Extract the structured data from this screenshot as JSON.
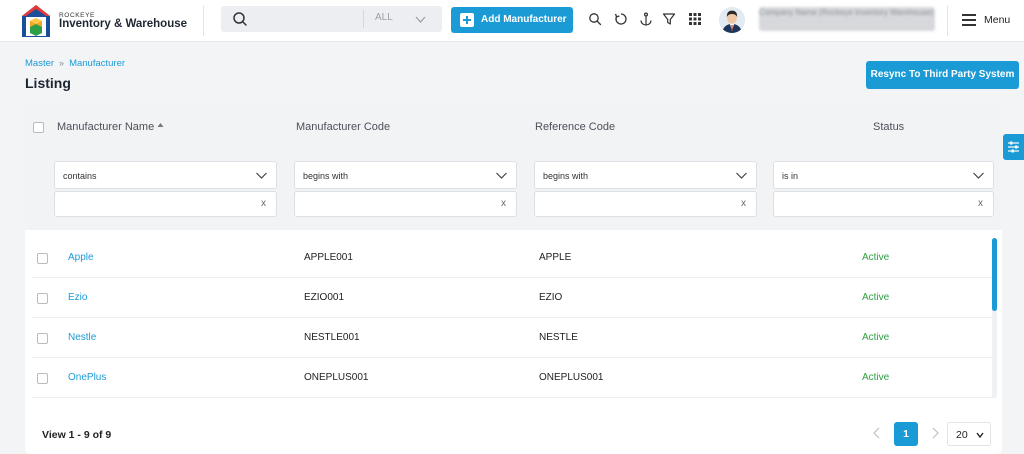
{
  "header": {
    "brand_small": "ROCKEYE",
    "brand_name": "Inventory & Warehouse",
    "search_scope": "ALL",
    "add_button": "Add Manufacturer",
    "user_detail": "Company Name (Rockeye Inventory Warehouse)",
    "menu_label": "Menu"
  },
  "page": {
    "breadcrumb": [
      "Master",
      "Manufacturer"
    ],
    "title": "Listing",
    "resync_button": "Resync To Third Party System"
  },
  "table": {
    "columns": [
      "Manufacturer Name",
      "Manufacturer Code",
      "Reference Code",
      "Status"
    ],
    "filters": [
      "contains",
      "begins with",
      "begins with",
      "is in"
    ],
    "clear_symbol": "x",
    "rows": [
      {
        "name": "Apple",
        "code": "APPLE001",
        "reference": "APPLE",
        "status": "Active"
      },
      {
        "name": "Ezio",
        "code": "EZIO001",
        "reference": "EZIO",
        "status": "Active"
      },
      {
        "name": "Nestle",
        "code": "NESTLE001",
        "reference": "NESTLE",
        "status": "Active"
      },
      {
        "name": "OnePlus",
        "code": "ONEPLUS001",
        "reference": "ONEPLUS001",
        "status": "Active"
      }
    ]
  },
  "pagination": {
    "summary": "View 1 - 9 of 9",
    "current_page": "1",
    "page_size": "20"
  },
  "colors": {
    "accent": "#1a9bd6",
    "status_active": "#2fa043"
  },
  "icons": [
    "search-icon",
    "chevron-down-icon",
    "plus-icon",
    "refresh-icon",
    "anchor-icon",
    "filter-icon",
    "grid-icon",
    "menu-icon",
    "sliders-icon",
    "chevron-left-icon",
    "chevron-right-icon",
    "sort-up-icon"
  ]
}
